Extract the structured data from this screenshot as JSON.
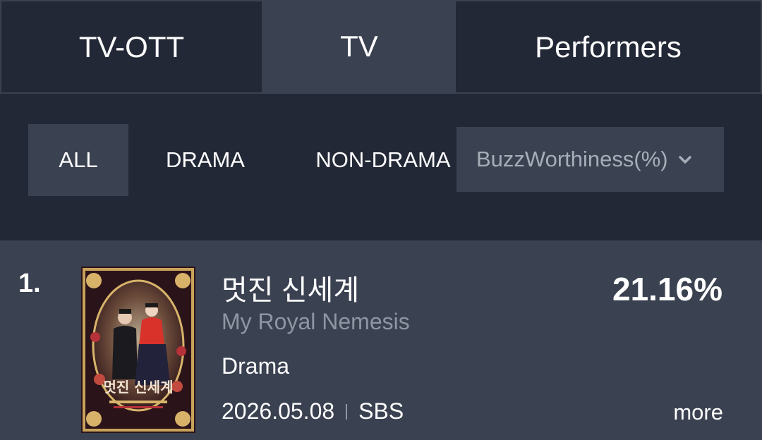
{
  "tabs": [
    {
      "label": "TV-OTT",
      "active": false
    },
    {
      "label": "TV",
      "active": true
    },
    {
      "label": "Performers",
      "active": false
    }
  ],
  "filters": [
    {
      "label": "ALL",
      "active": true
    },
    {
      "label": "DRAMA",
      "active": false
    },
    {
      "label": "NON-DRAMA",
      "active": false
    }
  ],
  "sort": {
    "label": "BuzzWorthiness(%)",
    "icon": "chevron-down-icon"
  },
  "list": [
    {
      "rank": "1.",
      "title_ko": "멋진 신세계",
      "title_en": "My Royal Nemesis",
      "genre": "Drama",
      "date": "2026.05.08",
      "channel": "SBS",
      "percent": "21.16%",
      "more_label": "more",
      "poster_title": "멋진 신세계"
    }
  ],
  "colors": {
    "background": "#222836",
    "active": "#3a4150",
    "muted_text": "#8f96a3"
  }
}
